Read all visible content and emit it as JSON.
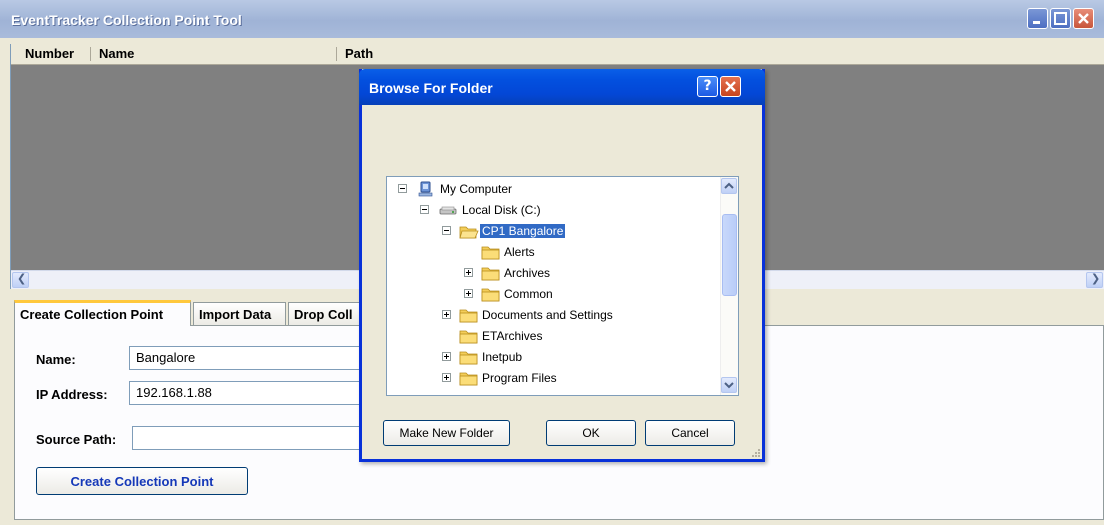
{
  "window": {
    "title": "EventTracker Collection Point Tool"
  },
  "list": {
    "columns": [
      "Number",
      "Name",
      "Path"
    ]
  },
  "tabs": [
    {
      "label": "Create Collection Point",
      "active": true
    },
    {
      "label": "Import Data",
      "active": false
    },
    {
      "label": "Drop Coll",
      "active": false
    }
  ],
  "form": {
    "name_label": "Name:",
    "name_value": "Bangalore",
    "ip_label": "IP Address:",
    "ip_value": "192.168.1.88",
    "source_label": "Source Path:",
    "source_value": "",
    "create_button": "Create Collection Point"
  },
  "dialog": {
    "title": "Browse For Folder",
    "help": "?",
    "tree": [
      {
        "label": "My Computer",
        "icon": "computer-icon",
        "expander": "minus"
      },
      {
        "label": "Local Disk (C:)",
        "icon": "drive-icon",
        "expander": "minus"
      },
      {
        "label": "CP1 Bangalore",
        "icon": "folder-open-icon",
        "expander": "minus",
        "selected": true
      },
      {
        "label": "Alerts",
        "icon": "folder-icon",
        "expander": "none"
      },
      {
        "label": "Archives",
        "icon": "folder-icon",
        "expander": "plus"
      },
      {
        "label": "Common",
        "icon": "folder-icon",
        "expander": "plus"
      },
      {
        "label": "Documents and Settings",
        "icon": "folder-icon",
        "expander": "plus"
      },
      {
        "label": "ETArchives",
        "icon": "folder-icon",
        "expander": "none"
      },
      {
        "label": "Inetpub",
        "icon": "folder-icon",
        "expander": "plus"
      },
      {
        "label": "Program Files",
        "icon": "folder-icon",
        "expander": "plus"
      }
    ],
    "make_new_folder": "Make New Folder",
    "ok": "OK",
    "cancel": "Cancel"
  },
  "colors": {
    "selection": "#316ac5",
    "dialog_title": "#0350df",
    "tab_highlight": "#ffc83c"
  }
}
